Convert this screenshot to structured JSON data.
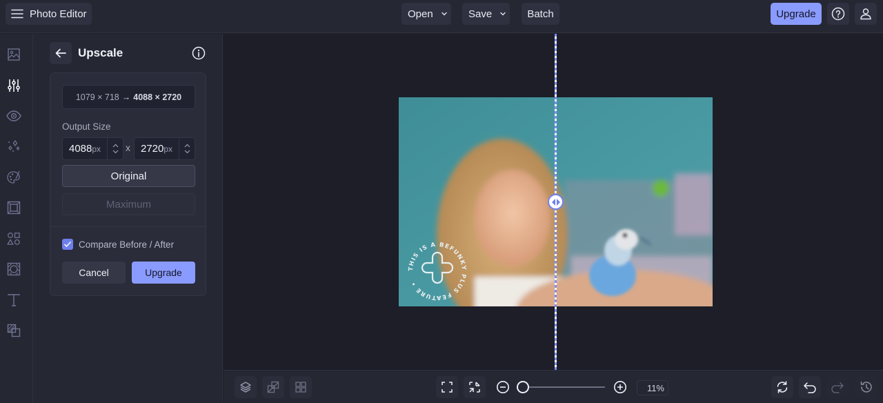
{
  "topbar": {
    "app_title": "Photo Editor",
    "menu_icon": "hamburger-menu-icon",
    "open_label": "Open",
    "save_label": "Save",
    "batch_label": "Batch",
    "upgrade_label": "Upgrade",
    "help_icon": "help-circle-icon",
    "account_icon": "user-icon"
  },
  "left_rail": {
    "items": [
      {
        "name": "image",
        "icon": "image-icon",
        "active": false
      },
      {
        "name": "edit",
        "icon": "sliders-icon",
        "active": true
      },
      {
        "name": "touch-up",
        "icon": "eye-icon",
        "active": false
      },
      {
        "name": "effects",
        "icon": "sparkles-icon",
        "active": false
      },
      {
        "name": "artsy",
        "icon": "palette-icon",
        "active": false
      },
      {
        "name": "frames",
        "icon": "frame-icon",
        "active": false
      },
      {
        "name": "graphics",
        "icon": "shapes-icon",
        "active": false
      },
      {
        "name": "overlays",
        "icon": "texture-icon",
        "active": false
      },
      {
        "name": "text",
        "icon": "text-icon",
        "active": false
      },
      {
        "name": "textures",
        "icon": "layers-swap-icon",
        "active": false
      }
    ]
  },
  "panel": {
    "title": "Upscale",
    "resolution": {
      "from": "1079 × 718",
      "arrow": "→",
      "to": "4088 × 2720"
    },
    "output_size_label": "Output Size",
    "width_value": "4088",
    "height_value": "2720",
    "unit": "px",
    "times": "x",
    "original_label": "Original",
    "maximum_label": "Maximum",
    "compare_label": "Compare Before / After",
    "compare_checked": true,
    "cancel_label": "Cancel",
    "upgrade_label": "Upgrade"
  },
  "canvas": {
    "watermark_text": "THIS IS A BEFUNKY PLUS FEATURE •",
    "split_position": 0.5
  },
  "bottombar": {
    "zoom_percent": "11%",
    "zoom_slider_value": 0.0
  },
  "colors": {
    "accent": "#8a9bff",
    "background": "#1d1e28",
    "panel": "#252733"
  }
}
